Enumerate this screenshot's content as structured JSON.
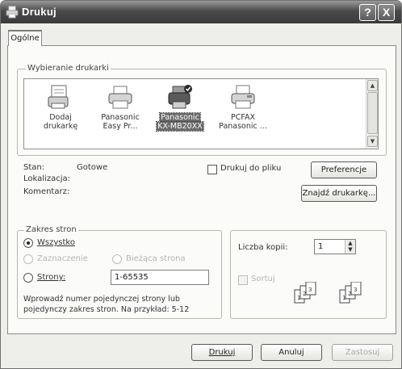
{
  "window": {
    "title": "Drukuj",
    "help_button": "?",
    "close_button": "X"
  },
  "tabs": [
    {
      "label": "Ogólne"
    }
  ],
  "printer_selection": {
    "legend": "Wybieranie drukarki",
    "printers": [
      {
        "line1": "Dodaj",
        "line2": "drukarkę",
        "icon": "add-printer-icon",
        "selected": false
      },
      {
        "line1": "Panasonic",
        "line2": "Easy Pr...",
        "icon": "printer-icon",
        "selected": false
      },
      {
        "line1": "Panasonic",
        "line2": "KX-MB20XX",
        "icon": "default-printer-icon",
        "selected": true
      },
      {
        "line1": "PCFAX",
        "line2": "Panasonic ...",
        "icon": "fax-printer-icon",
        "selected": false
      }
    ],
    "status_label": "Stan:",
    "status_value": "Gotowe",
    "location_label": "Lokalizacja:",
    "location_value": "",
    "comment_label": "Komentarz:",
    "comment_value": "",
    "print_to_file_label": "Drukuj do pliku",
    "preferences_button": "Preferencje",
    "find_printer_button": "Znajdź drukarkę..."
  },
  "page_range": {
    "legend": "Zakres stron",
    "all_label": "Wszystko",
    "selection_label": "Zaznaczenie",
    "current_page_label": "Bieżąca strona",
    "pages_label": "Strony:",
    "pages_value": "1-65535",
    "help_text_line1": "Wprowadź numer pojedynczej strony lub",
    "help_text_line2": "pojedynczy zakres stron. Na przykład: 5-12"
  },
  "copies": {
    "count_label": "Liczba kopii:",
    "count_value": "1",
    "collate_label": "Sortuj"
  },
  "footer": {
    "print_button": "Drukuj",
    "cancel_button": "Anuluj",
    "apply_button": "Zastosuj"
  },
  "colors": {
    "titlebar": "#4a4a4a",
    "selection": "#6a6a6a"
  }
}
